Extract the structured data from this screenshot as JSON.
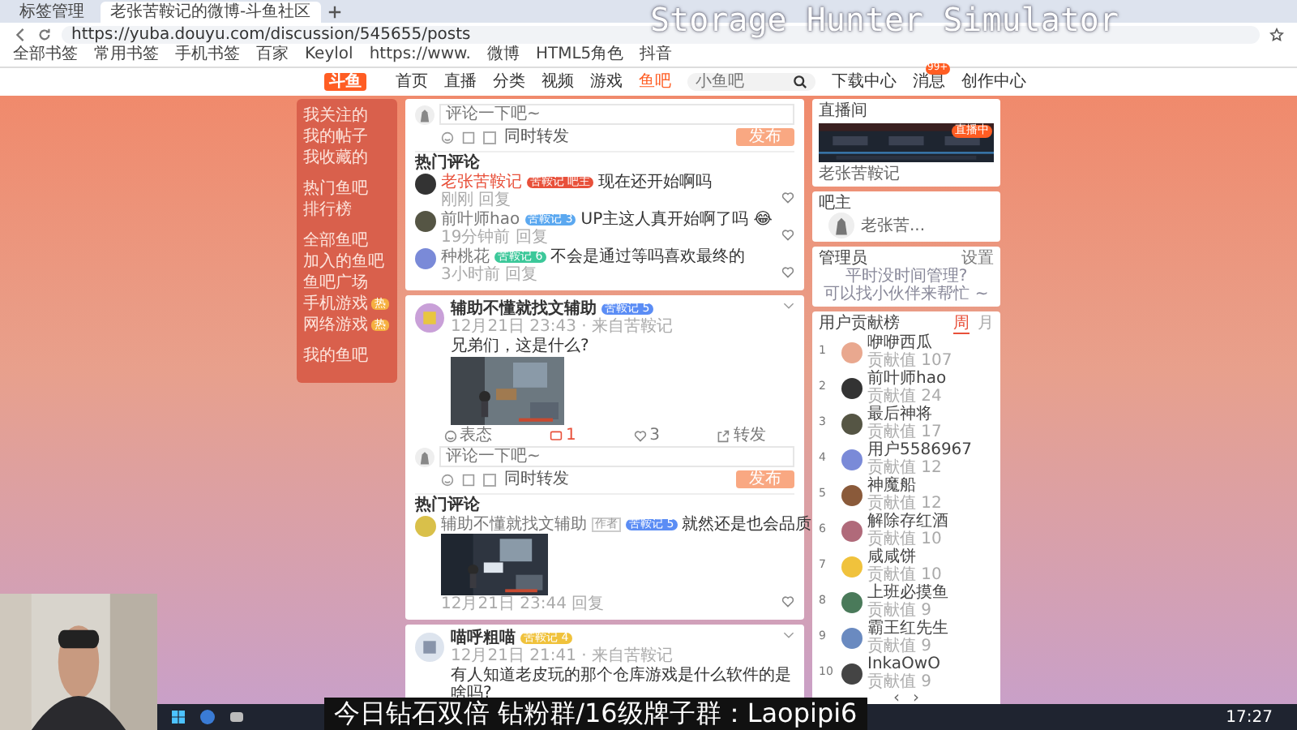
{
  "overlay_title": "Storage Hunter Simulator",
  "browser": {
    "tabs": [
      {
        "label": "标签管理",
        "selected": false
      },
      {
        "label": "老张苦鞍记的微博-斗鱼社区",
        "selected": true
      }
    ],
    "url": "https://yuba.douyu.com/discussion/545655/posts",
    "bookmarks": [
      "全部书签",
      "常用书签",
      "手机书签",
      "百家",
      "Keylol",
      "https://www.",
      "微博",
      "HTML5角色",
      "抖音"
    ]
  },
  "site": {
    "logo": "斗鱼",
    "nav": [
      {
        "label": "首页",
        "selected": false
      },
      {
        "label": "直播",
        "selected": false
      },
      {
        "label": "分类",
        "selected": false
      },
      {
        "label": "视频",
        "selected": false
      },
      {
        "label": "游戏",
        "selected": false
      },
      {
        "label": "鱼吧",
        "selected": true
      }
    ],
    "search": {
      "placeholder": "小鱼吧"
    },
    "tools": [
      "下载中心",
      "消息",
      "创作中心"
    ],
    "message_badge": "99+"
  },
  "sidebar": [
    [
      {
        "label": "我关注的"
      },
      {
        "label": "我的帖子"
      },
      {
        "label": "我收藏的"
      }
    ],
    [
      {
        "label": "热门鱼吧"
      },
      {
        "label": "排行榜"
      }
    ],
    [
      {
        "label": "全部鱼吧"
      },
      {
        "label": "加入的鱼吧"
      },
      {
        "label": "鱼吧广场"
      },
      {
        "label": "手机游戏",
        "badge": "热"
      },
      {
        "label": "网络游戏",
        "badge": "热"
      }
    ],
    [
      {
        "label": "我的鱼吧"
      }
    ]
  ],
  "composer_top": {
    "placeholder": "评论一下吧~",
    "repost": "同时转发",
    "repost_checked": false,
    "submit": "发布"
  },
  "hot_top": {
    "title": "热门评论",
    "comments": [
      {
        "user": "老张苦鞍记",
        "is_owner": true,
        "badge": {
          "text": "苦鞍记 吧主",
          "color": "#e8503a"
        },
        "text": "现在还开始啊吗",
        "meta": "刚刚  回复"
      },
      {
        "user": "前叶师hao",
        "is_owner": false,
        "badge": {
          "text": "苦鞍记 3",
          "color": "#5ba8f0"
        },
        "text": "UP主这人真开始啊了吗 😂",
        "meta": "19分钟前  回复"
      },
      {
        "user": "种桃花",
        "is_owner": false,
        "badge": {
          "text": "苦鞍记 6",
          "color": "#3cc89a"
        },
        "text": "不会是通过等吗喜欢最终的",
        "meta": "3小时前  回复"
      }
    ]
  },
  "post": {
    "author": "辅助不懂就找文辅助",
    "badge": {
      "text": "苦鞍记 5",
      "color": "#5b8df5"
    },
    "time": "12月21日 23:43 · 来自苦鞍记",
    "text": "兄弟们，这是什么?",
    "actions": [
      {
        "kind": "react",
        "label": "表态"
      },
      {
        "kind": "comment",
        "label": "1"
      },
      {
        "kind": "like",
        "label": "3"
      },
      {
        "kind": "share",
        "label": "转发"
      }
    ],
    "composer": {
      "placeholder": "评论一下吧~",
      "repost": "同时转发",
      "repost_checked": false,
      "submit": "发布"
    },
    "hot": {
      "title": "热门评论",
      "comment": {
        "user": "辅助不懂就找文辅助",
        "role": "作者",
        "badge": {
          "text": "苦鞍记 5",
          "color": "#5b8df5"
        },
        "text": "就然还是也会品质",
        "meta": "12月21日 23:44  回复"
      }
    }
  },
  "post2": {
    "author": "喵呼粗喵",
    "badge": {
      "text": "苦鞍记 4",
      "color": "#f0c23c"
    },
    "time": "12月21日 21:41 · 来自苦鞍记",
    "text": "有人知道老皮玩的那个仓库游戏是什么软件的是啥吗?"
  },
  "right": {
    "live": {
      "title": "直播间",
      "badge": "直播中",
      "caption": "老张苦鞍记"
    },
    "owner": {
      "title": "吧主",
      "name": "老张苦..."
    },
    "admins": {
      "title": "管理员",
      "action": "设置",
      "note": [
        "平时没时间管理?",
        "可以找小伙伴来帮忙 ~"
      ]
    },
    "board": {
      "title": "用户贡献榜",
      "tabs": [
        {
          "label": "周",
          "selected": true
        },
        {
          "label": "月",
          "selected": false
        }
      ],
      "rows": [
        {
          "rank": "1",
          "name": "咿咿西瓜",
          "value": "贡献值 107"
        },
        {
          "rank": "2",
          "name": "前叶师hao",
          "value": "贡献值 24"
        },
        {
          "rank": "3",
          "name": "最后神将",
          "value": "贡献值 17"
        },
        {
          "rank": "4",
          "name": "用户5586967",
          "value": "贡献值 12"
        },
        {
          "rank": "5",
          "name": "神魔船",
          "value": "贡献值 12"
        },
        {
          "rank": "6",
          "name": "解除存红酒",
          "value": "贡献值 10"
        },
        {
          "rank": "7",
          "name": "咸咸饼",
          "value": "贡献值 10"
        },
        {
          "rank": "8",
          "name": "上班必摸鱼",
          "value": "贡献值 9"
        },
        {
          "rank": "9",
          "name": "霸王红先生",
          "value": "贡献值 9"
        },
        {
          "rank": "10",
          "name": "InkaOwO",
          "value": "贡献值 9"
        }
      ],
      "pager": [
        "‹",
        "›"
      ]
    }
  },
  "subtitle": "今日钻石双倍 钻粉群/16级牌子群：Laopipi6",
  "clock": "17:27"
}
